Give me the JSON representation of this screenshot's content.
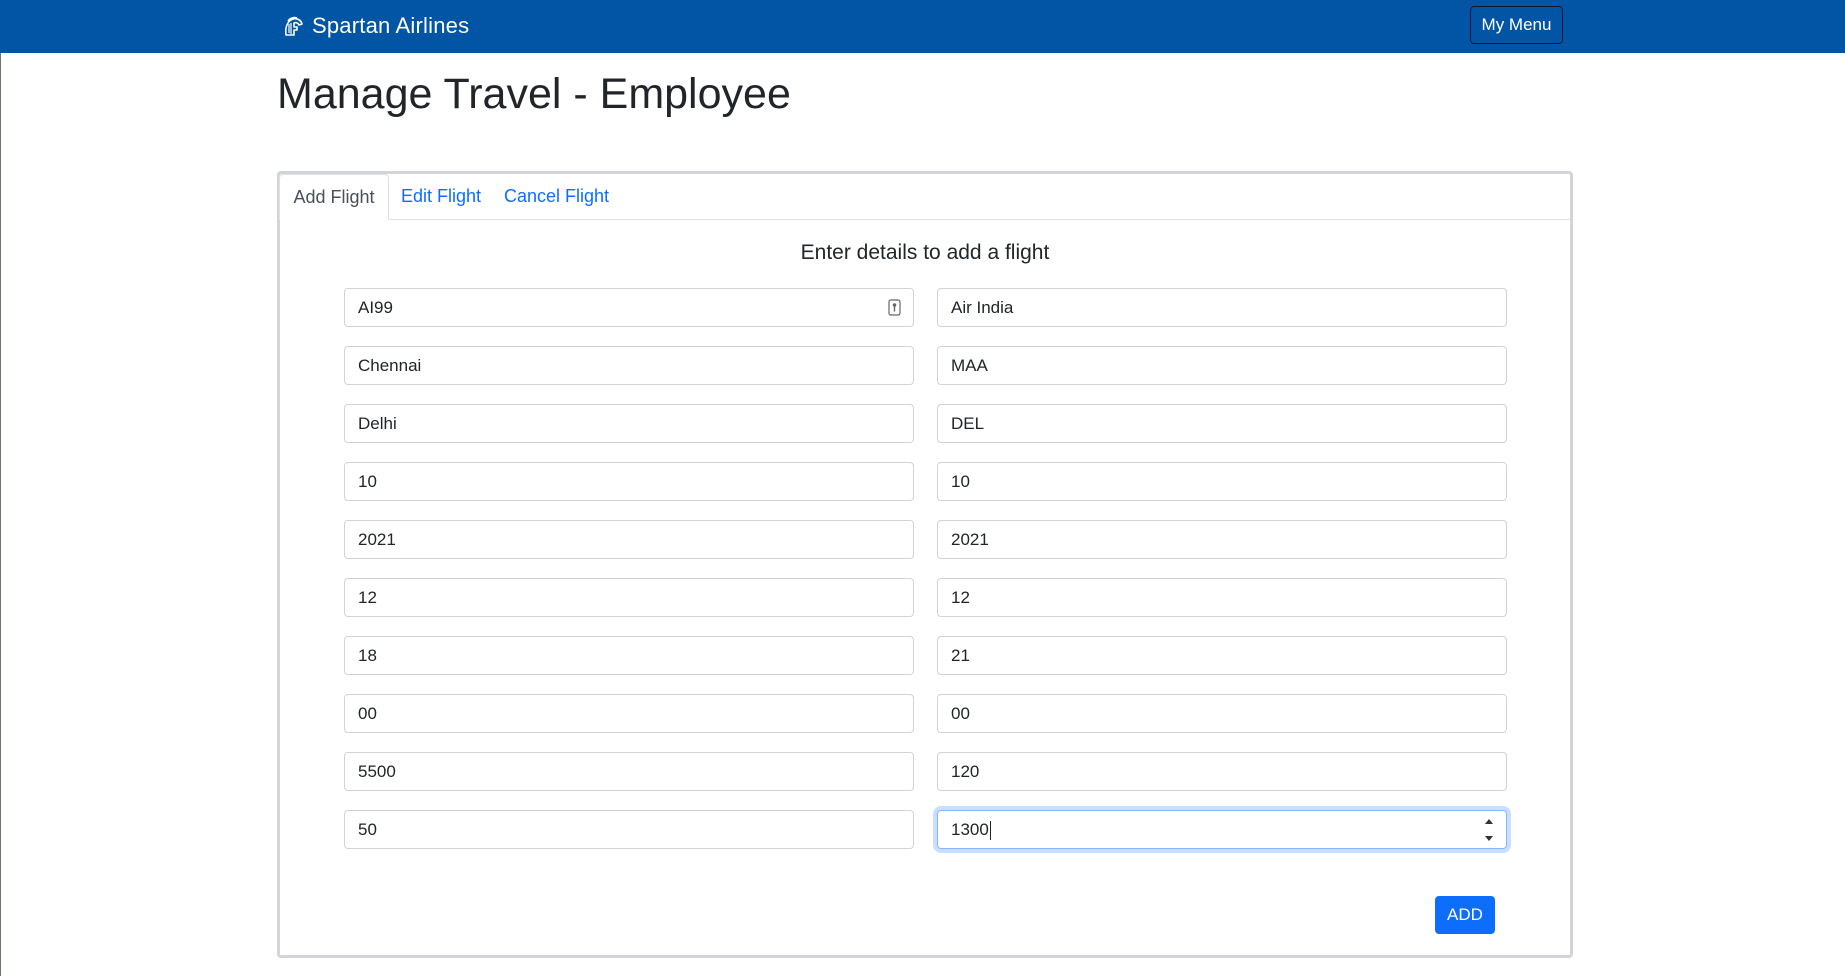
{
  "navbar": {
    "brand": "Spartan Airlines",
    "brand_icon": "spartan-helmet-icon",
    "menu_button": "My Menu",
    "background_color": "#0255a5"
  },
  "page_title": "Manage Travel - Employee",
  "tabs": [
    {
      "label": "Add Flight",
      "active": true
    },
    {
      "label": "Edit Flight",
      "active": false
    },
    {
      "label": "Cancel Flight",
      "active": false
    }
  ],
  "form": {
    "heading": "Enter details to add a flight",
    "rows": [
      {
        "left": "AI99",
        "right": "Air India"
      },
      {
        "left": "Chennai",
        "right": "MAA"
      },
      {
        "left": "Delhi",
        "right": "DEL"
      },
      {
        "left": "10",
        "right": "10"
      },
      {
        "left": "2021",
        "right": "2021"
      },
      {
        "left": "12",
        "right": "12"
      },
      {
        "left": "18",
        "right": "21"
      },
      {
        "left": "00",
        "right": "00"
      },
      {
        "left": "5500",
        "right": "120"
      },
      {
        "left": "50",
        "right": "1300"
      }
    ],
    "submit_label": "ADD",
    "accent_color": "#0d6efd"
  }
}
